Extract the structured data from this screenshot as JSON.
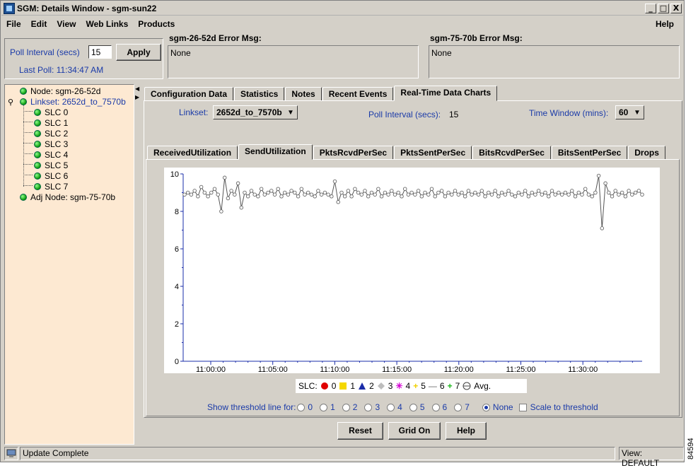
{
  "window": {
    "title": "SGM: Details Window - sgm-sun22",
    "minimize": "_",
    "maximize": "□",
    "close": "X"
  },
  "menu": {
    "file": "File",
    "edit": "Edit",
    "view": "View",
    "weblinks": "Web Links",
    "products": "Products",
    "help": "Help"
  },
  "poll": {
    "label": "Poll Interval (secs)",
    "value": "15",
    "apply": "Apply",
    "last_poll": "Last Poll:  11:34:47 AM"
  },
  "errors": [
    {
      "label": "sgm-26-52d  Error Msg:",
      "value": "None"
    },
    {
      "label": "sgm-75-70b  Error Msg:",
      "value": "None"
    }
  ],
  "tree": {
    "node": "Node: sgm-26-52d",
    "linkset": "Linkset: 2652d_to_7570b",
    "slcs": [
      "SLC 0",
      "SLC 1",
      "SLC 2",
      "SLC 3",
      "SLC 4",
      "SLC 5",
      "SLC 6",
      "SLC 7"
    ],
    "adj": "Adj Node: sgm-75-70b"
  },
  "main_tabs": [
    "Configuration Data",
    "Statistics",
    "Notes",
    "Recent Events",
    "Real-Time Data Charts"
  ],
  "controls": {
    "linkset_label": "Linkset:",
    "linkset_value": "2652d_to_7570b",
    "poll_label": "Poll Interval (secs):",
    "poll_value": "15",
    "window_label": "Time Window (mins):",
    "window_value": "60"
  },
  "sub_tabs": [
    "ReceivedUtilization",
    "SendUtilization",
    "PktsRcvdPerSec",
    "PktsSentPerSec",
    "BitsRcvdPerSec",
    "BitsSentPerSec",
    "Drops"
  ],
  "chart_data": {
    "type": "line",
    "ylim": [
      0,
      10
    ],
    "yticks": [
      "0",
      "2",
      "4",
      "6",
      "8",
      "10"
    ],
    "xticks": [
      "11:00:00",
      "11:05:00",
      "11:10:00",
      "11:15:00",
      "11:20:00",
      "11:25:00",
      "11:30:00"
    ],
    "series": [
      {
        "values": [
          8.9,
          9.0,
          8.9,
          9.1,
          8.8,
          9.3,
          9.0,
          8.8,
          9.0,
          9.2,
          8.9,
          8.0,
          9.8,
          8.7,
          9.1,
          8.9,
          9.5,
          8.2,
          9.0,
          8.8,
          9.1,
          8.9,
          8.8,
          9.2,
          8.9,
          9.0,
          9.1,
          8.9,
          9.2,
          8.8,
          9.0,
          8.9,
          9.1,
          9.0,
          8.8,
          9.2,
          8.9,
          9.0,
          8.9,
          8.8,
          9.1,
          8.9,
          9.0,
          8.9,
          8.8,
          9.6,
          8.5,
          9.0,
          8.8,
          9.1,
          8.8,
          9.2,
          9.0,
          8.9,
          9.1,
          8.8,
          9.0,
          8.9,
          9.2,
          8.8,
          9.0,
          8.9,
          9.1,
          8.9,
          9.0,
          8.8,
          9.2,
          8.9,
          9.0,
          8.9,
          9.1,
          8.8,
          9.0,
          8.9,
          9.2,
          8.8,
          9.0,
          9.1,
          8.8,
          9.0,
          8.9,
          9.1,
          8.9,
          9.0,
          8.8,
          9.1,
          8.9,
          9.0,
          8.9,
          9.1,
          8.8,
          9.0,
          8.9,
          9.1,
          8.8,
          9.0,
          8.9,
          9.1,
          8.9,
          8.8,
          9.0,
          8.9,
          9.1,
          8.8,
          9.0,
          8.9,
          9.1,
          8.9,
          9.0,
          8.8,
          9.1,
          8.9,
          9.0,
          8.9,
          9.0,
          8.9,
          9.1,
          8.8,
          9.0,
          8.9,
          9.2,
          8.9,
          8.8,
          9.0,
          9.9,
          7.1,
          9.5,
          9.0,
          8.8,
          9.1,
          8.9,
          9.0,
          8.8,
          9.1,
          8.9,
          9.0,
          9.1,
          8.9
        ]
      }
    ]
  },
  "legend": {
    "label": "SLC:",
    "items": [
      "0",
      "1",
      "2",
      "3",
      "4",
      "5",
      "6",
      "7",
      "Avg."
    ]
  },
  "threshold": {
    "label": "Show threshold line for:",
    "options": [
      "0",
      "1",
      "2",
      "3",
      "4",
      "5",
      "6",
      "7",
      "None"
    ],
    "scale": "Scale to threshold"
  },
  "buttons": {
    "reset": "Reset",
    "grid": "Grid On",
    "help": "Help"
  },
  "status": {
    "message": "Update Complete",
    "view": "View: DEFAULT"
  },
  "figure_id": "84594"
}
